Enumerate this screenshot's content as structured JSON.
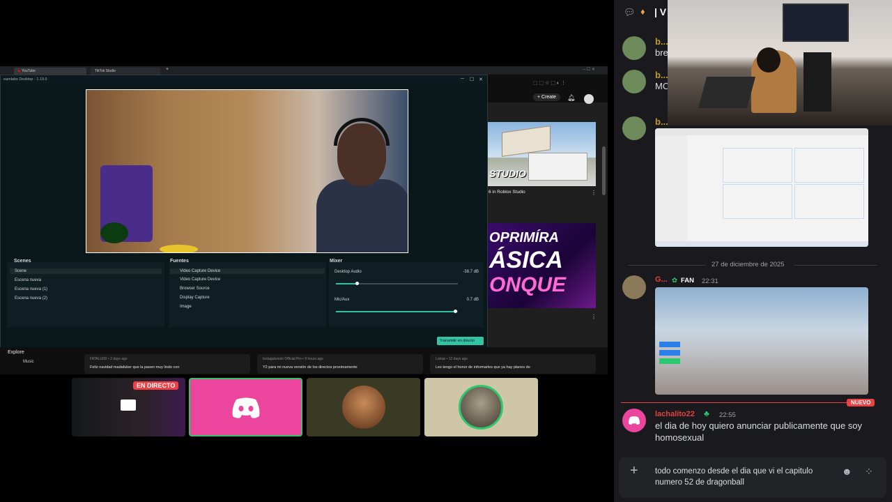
{
  "browser": {
    "tab1": "YouTube",
    "tab2": "TikTok Studio",
    "new_tab": "+"
  },
  "streamlabs": {
    "title": "eamlabs Desktop - 1.19.6",
    "scenes_title": "Scenes",
    "scenes": [
      "Scene",
      "Escena nueva",
      "Escena nueva (1)",
      "Escena nueva (2)"
    ],
    "sources_title": "Fuentes",
    "sources": [
      "Video Capture Device",
      "Video Capture Device",
      "Browser Source",
      "Display Capture",
      "Image"
    ],
    "mixer_title": "Mixer",
    "mixer": [
      {
        "name": "Desktop Audio",
        "db": "-38.7 dB",
        "level": 0.18
      },
      {
        "name": "Mic/Aux",
        "db": "0.7 dB",
        "level": 1.0
      }
    ],
    "go_live": "Transmitir en directo"
  },
  "youtube": {
    "create_label": "+ Create",
    "thumb1_label": "STUDIO",
    "thumb1_title": "6 in Roblox Studio",
    "thumb2_lines": [
      "OPRIMÍRA",
      "ÁSICA",
      "ONQUE"
    ],
    "explore": "Explore",
    "music": "Music",
    "posts": [
      {
        "author": "FATALUIDI • 2 days ago",
        "text": "Feliz navidad madafuker que la pasen muy lindo con"
      },
      {
        "author": "Instagutunnin Official Pro • 9 hours ago",
        "text": "Y2 para mi nueva versión de los directos proximamente"
      },
      {
        "author": "Lotnar • 12 days ago",
        "text": "Les tengo el honor de informarles que ya hay planes de"
      }
    ]
  },
  "participants": {
    "live_badge": "EN DIRECTO"
  },
  "chat": {
    "channel_fragment": "| V",
    "messages_top": [
      {
        "user": "b...",
        "text": "bre"
      },
      {
        "user": "b...",
        "text": "MC"
      },
      {
        "user": "b...",
        "text": ""
      }
    ],
    "date_divider": "27 de diciembre de 2025",
    "fan_message": {
      "user": "G...",
      "badge": "FAN",
      "time": "22:31"
    },
    "new_label": "NUEVO",
    "last_message": {
      "user": "lachalito22",
      "time": "22:55",
      "text": "el dia de  hoy quiero anunciar publicamente que  soy homosexual"
    },
    "composer_text": "todo comenzo desde el dia que vi el capitulo numero 52 de dragonball",
    "colors": {
      "background": "#1a1a1e",
      "username_gold": "#c29a2a",
      "username_red": "#e0433f",
      "accent_red": "#ed4245",
      "discord_pink": "#eb459e"
    }
  }
}
